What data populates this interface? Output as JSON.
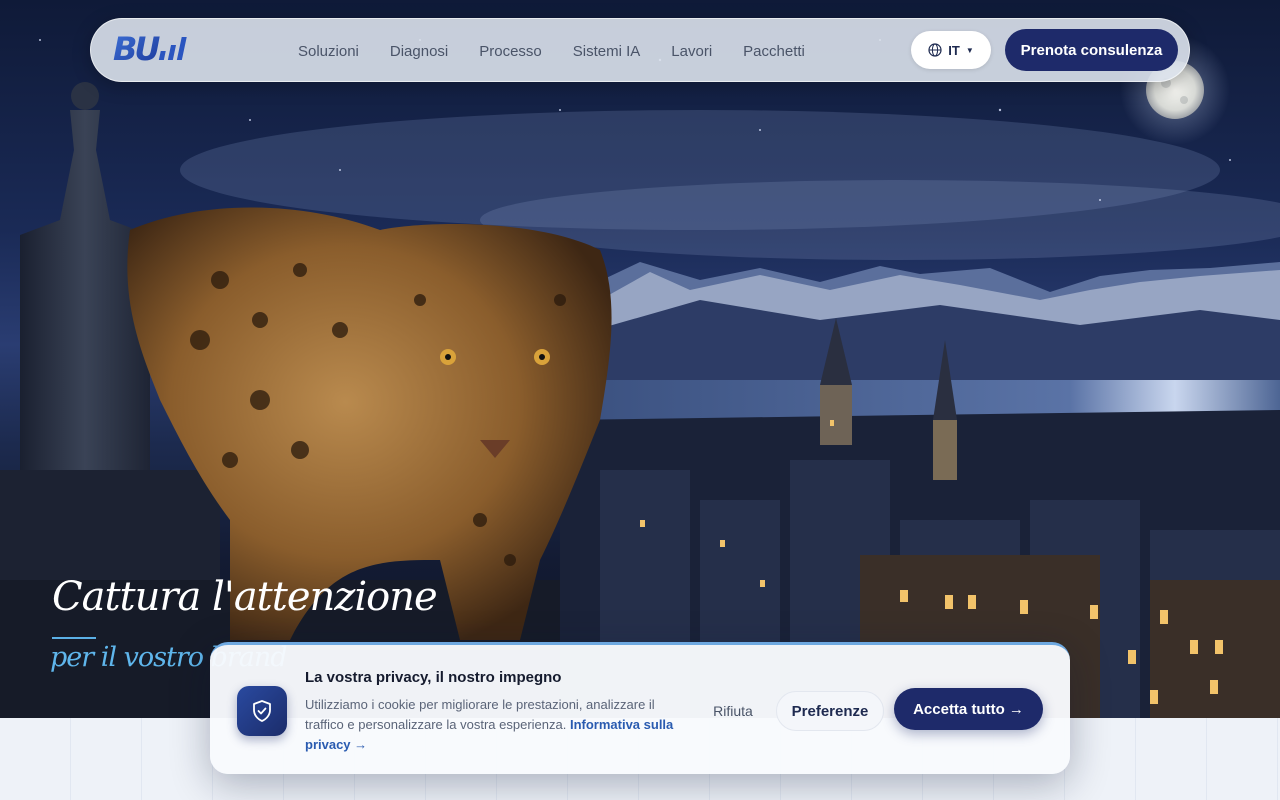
{
  "nav": {
    "logo_text": "BU",
    "links": [
      "Soluzioni",
      "Diagnosi",
      "Processo",
      "Sistemi IA",
      "Lavori",
      "Pacchetti"
    ],
    "language": "IT",
    "cta_label": "Prenota consulenza"
  },
  "hero": {
    "title": "Cattura l'attenzione",
    "subtitle": "per il vostro brand"
  },
  "cookie": {
    "title": "La vostra privacy, il nostro impegno",
    "body": "Utilizziamo i cookie per migliorare le prestazioni, analizzare il traffico e personalizzare la vostra esperienza.",
    "link": "Informativa sulla privacy →",
    "reject_label": "Rifiuta",
    "preferences_label": "Preferenze",
    "accept_label": "Accetta tutto →"
  },
  "icons": {
    "globe": "globe-icon",
    "shield": "shield-check-icon",
    "moon": "moon-icon"
  },
  "colors": {
    "primary": "#1e2a6a",
    "accent": "#5fb6ec",
    "link": "#2a5bb0"
  }
}
